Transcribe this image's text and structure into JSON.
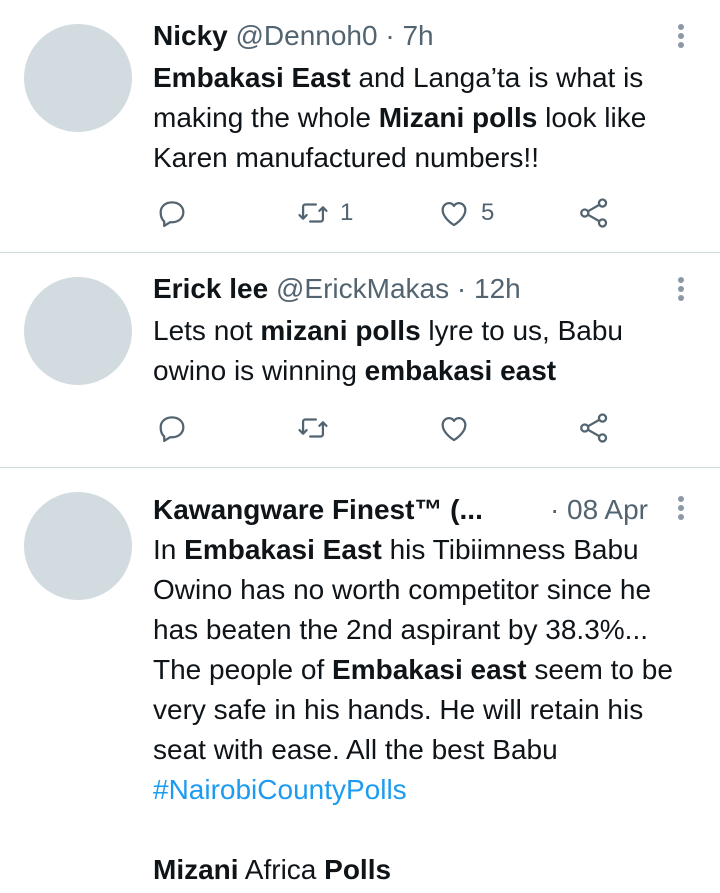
{
  "tweets": [
    {
      "name": "Nicky",
      "handle": "@Dennoh0",
      "time": "· 7h",
      "body": [
        {
          "t": "Embakasi East",
          "b": true
        },
        {
          "t": " and Langa’ta is what is making the whole "
        },
        {
          "t": "Mizani polls",
          "b": true
        },
        {
          "t": " look like Karen manufactured numbers!!"
        }
      ],
      "reply_count": "",
      "retweet_count": "1",
      "like_count": "5"
    },
    {
      "name": "Erick lee",
      "handle": "@ErickMakas",
      "time": "· 12h",
      "body": [
        {
          "t": "Lets not "
        },
        {
          "t": "mizani  polls",
          "b": true
        },
        {
          "t": " lyre  to us, Babu owino is  winning "
        },
        {
          "t": "embakasi east",
          "b": true
        }
      ],
      "reply_count": "",
      "retweet_count": "",
      "like_count": ""
    },
    {
      "name": "Kawangware Finest™ (...",
      "handle": "",
      "time": "· 08 Apr",
      "body": [
        {
          "t": "In "
        },
        {
          "t": "Embakasi East",
          "b": true
        },
        {
          "t": " his Tibiimness Babu Owino has no worth competitor since he has beaten the 2nd aspirant by 38.3%... The people of "
        },
        {
          "t": "Embakasi east",
          "b": true
        },
        {
          "t": " seem to be very safe in his hands. He will retain his seat with ease. All the best Babu "
        },
        {
          "t": "#NairobiCountyPolls",
          "h": true
        },
        {
          "t": "\n\n"
        },
        {
          "t": "Mizani",
          "b": true
        },
        {
          "t": " Africa "
        },
        {
          "t": "Polls",
          "b": true
        }
      ]
    }
  ],
  "icons": {
    "reply": "reply-icon",
    "retweet": "retweet-icon",
    "like": "heart-icon",
    "share": "share-icon",
    "more": "more-vertical-icon"
  },
  "colors": {
    "text": "#0f1419",
    "meta": "#536471",
    "hashtag": "#1d9bf0",
    "divider": "#cfd9de",
    "avatar": "#d2dbe0"
  }
}
